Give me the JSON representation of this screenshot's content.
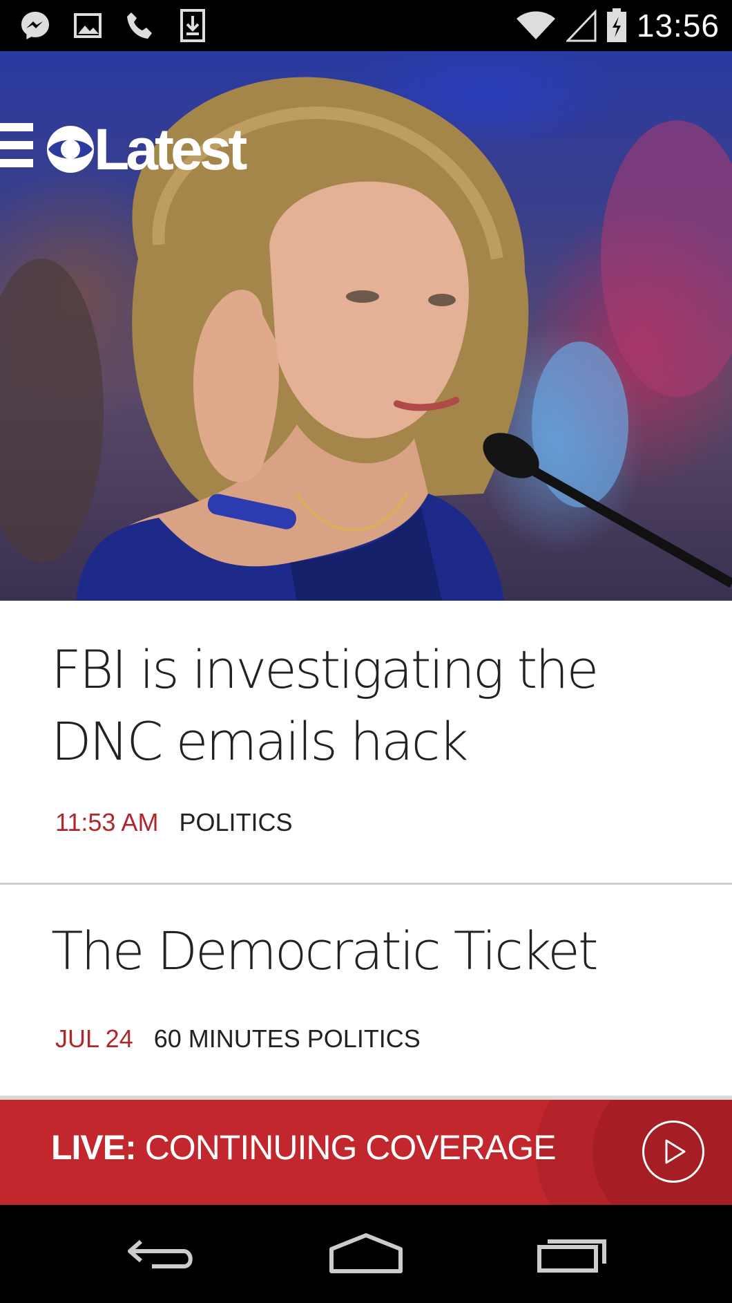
{
  "status_bar": {
    "time": "13:56",
    "left_icons": [
      "messenger-icon",
      "gallery-icon",
      "phone-icon",
      "download-icon"
    ],
    "right_icons": [
      "wifi-icon",
      "cell-signal-icon",
      "battery-charging-icon"
    ]
  },
  "header": {
    "app_name": "Latest",
    "logo": "cbs-eye-logo"
  },
  "stories": [
    {
      "title": "FBI is investigating the DNC emails hack",
      "time": "11:53 AM",
      "category": "POLITICS"
    },
    {
      "title": "The Democratic Ticket",
      "time": "JUL 24",
      "category": "60 MINUTES POLITICS"
    }
  ],
  "live_bar": {
    "label": "LIVE:",
    "text": "CONTINUING COVERAGE",
    "color": "#c2272e"
  },
  "nav": [
    "back-icon",
    "home-icon",
    "recents-icon"
  ],
  "colors": {
    "accent": "#b0262b",
    "live": "#c2272e"
  }
}
